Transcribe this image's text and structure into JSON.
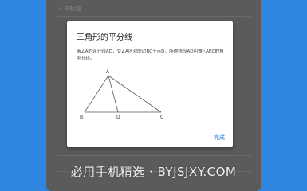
{
  "background": {
    "top_label": "• 书标题"
  },
  "dialog": {
    "title": "三角形的平分线",
    "body": "画∠A的评分线AD，交∠A所对的边BC于点D，所得线段AD叫做△ABC的角平分线。",
    "figure": {
      "vertices": [
        "A",
        "B",
        "D",
        "C"
      ]
    },
    "done_label": "完成"
  },
  "watermark": "必用手机精选 · BYJSJXY.COM",
  "colors": {
    "brand_blue": "#2f86e0",
    "overlay_gray": "#5b5b5b",
    "dialog_bg": "#ffffff"
  }
}
